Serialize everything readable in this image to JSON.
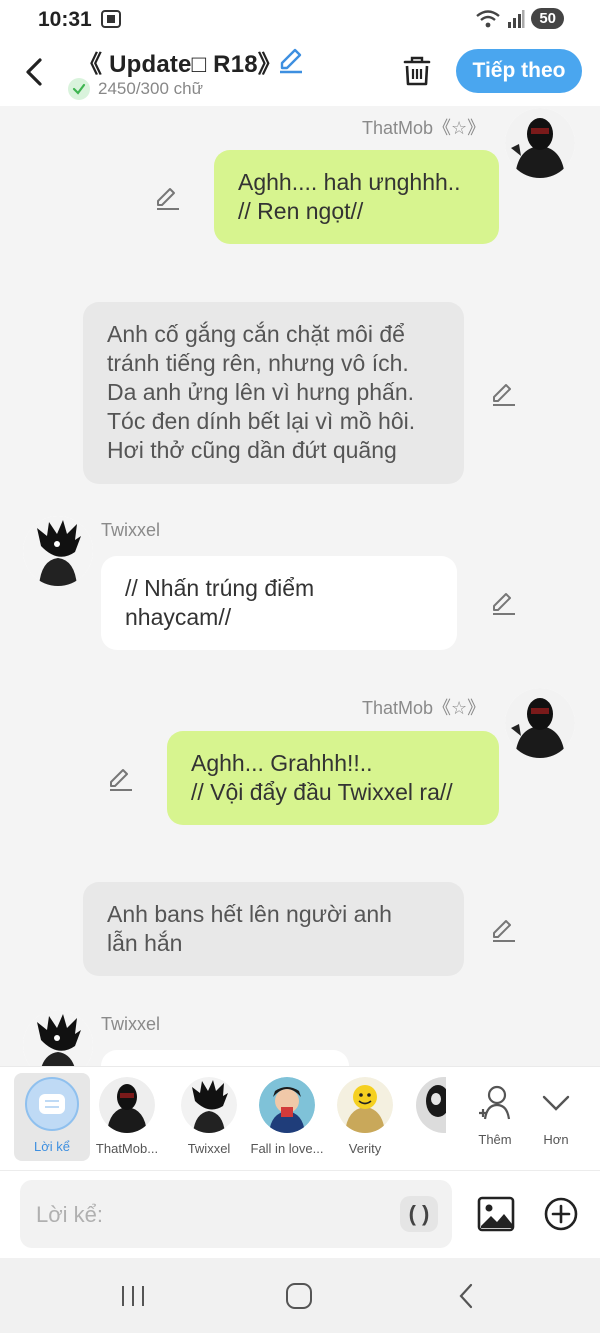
{
  "status": {
    "time": "10:31",
    "battery": "50"
  },
  "header": {
    "title": "《 Update□ R18》",
    "word_count": "2450/300 chữ",
    "next_label": "Tiếp theo"
  },
  "messages": [
    {
      "speaker": "ThatMob《☆》",
      "lines": [
        "Aghh.... hah ưnghhh..",
        "// Ren ngọt//"
      ]
    },
    {
      "speaker": "",
      "lines": [
        "Anh cố gắng cắn chặt môi để",
        "tránh tiếng rên, nhưng vô ích.",
        "Da anh ửng lên vì hưng phấn.",
        "Tóc đen dính bết lại vì mồ hôi.",
        "Hơi thở cũng dần đứt quãng"
      ]
    },
    {
      "speaker": "Twixxel",
      "lines": [
        "// Nhấn trúng điểm",
        "nhaycam//"
      ]
    },
    {
      "speaker": "ThatMob《☆》",
      "lines": [
        "Aghh... Grahhh!!..",
        "// Vội đẩy đầu Twixxel ra//"
      ]
    },
    {
      "speaker": "",
      "lines": [
        "Anh bans hết lên người anh",
        "lẫn hắn"
      ]
    },
    {
      "speaker": "Twixxel",
      "lines": []
    }
  ],
  "characters": [
    {
      "label": "Lời kể"
    },
    {
      "label": "ThatMob..."
    },
    {
      "label": "Twixxel"
    },
    {
      "label": "Fall in love..."
    },
    {
      "label": "Verity"
    },
    {
      "label": ""
    }
  ],
  "more_actions": {
    "add_label": "Thêm",
    "more_label": "Hơn"
  },
  "input": {
    "placeholder": "Lời kể:",
    "paren_label": "( )"
  },
  "colors": {
    "accent": "#4aa6ef",
    "bubble_green": "#d7f48f",
    "narration_gray": "#e8e8e8"
  }
}
